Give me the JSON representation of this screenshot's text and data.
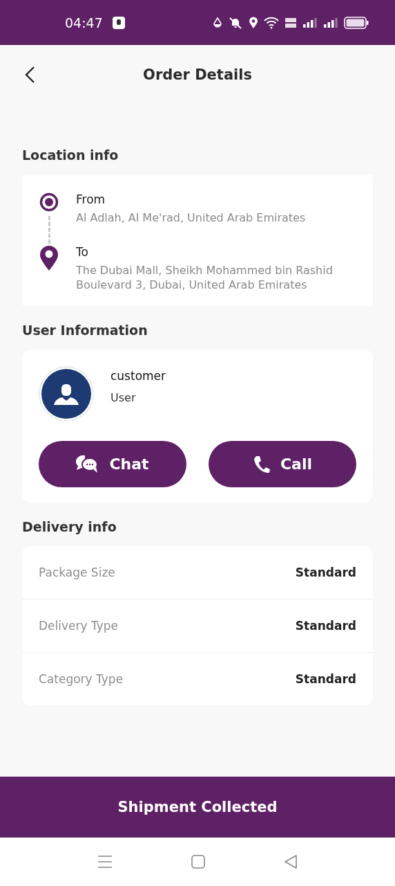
{
  "status_bar": {
    "time": "04:47"
  },
  "header": {
    "title": "Order Details"
  },
  "location": {
    "heading": "Location info",
    "stops": [
      {
        "kind": "origin",
        "label": "From",
        "address": "Al Adlah, Al Me'rad, United Arab Emirates"
      },
      {
        "kind": "destination",
        "label": "To",
        "address": "The Dubai Mall, Sheikh Mohammed bin Rashid Boulevard 3, Dubai, United Arab Emirates"
      }
    ]
  },
  "user": {
    "heading": "User Information",
    "name": "customer",
    "role": "User",
    "actions": [
      {
        "kind": "chat",
        "label": "Chat"
      },
      {
        "kind": "call",
        "label": "Call"
      }
    ]
  },
  "delivery": {
    "heading": "Delivery info",
    "rows": [
      {
        "label": "Package Size",
        "value": "Standard"
      },
      {
        "label": "Delivery Type",
        "value": "Standard"
      },
      {
        "label": "Category Type",
        "value": "Standard"
      }
    ]
  },
  "footer_button": {
    "label": "Shipment Collected"
  }
}
